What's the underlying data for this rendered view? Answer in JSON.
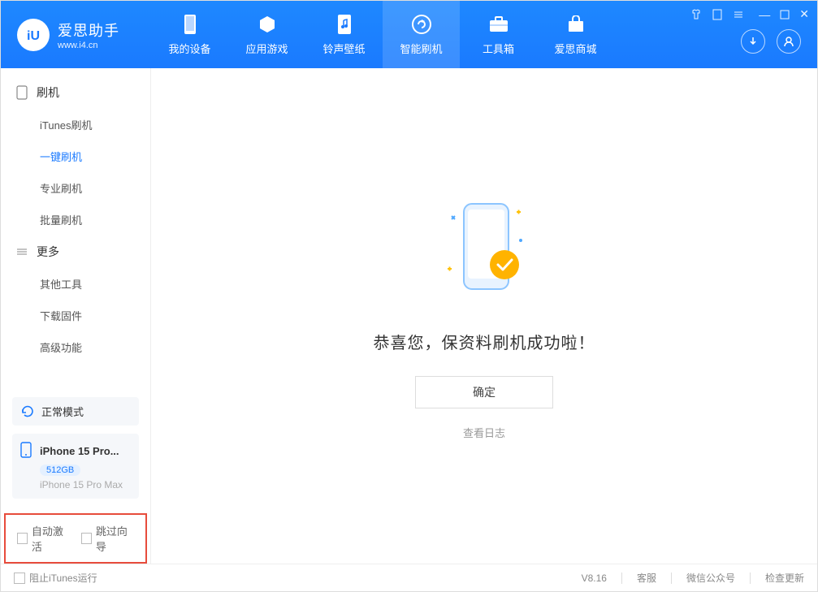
{
  "app": {
    "title": "爱思助手",
    "url": "www.i4.cn",
    "version": "V8.16"
  },
  "nav": {
    "tabs": [
      {
        "label": "我的设备"
      },
      {
        "label": "应用游戏"
      },
      {
        "label": "铃声壁纸"
      },
      {
        "label": "智能刷机"
      },
      {
        "label": "工具箱"
      },
      {
        "label": "爱思商城"
      }
    ]
  },
  "sidebar": {
    "group1": {
      "title": "刷机"
    },
    "items1": [
      {
        "label": "iTunes刷机"
      },
      {
        "label": "一键刷机"
      },
      {
        "label": "专业刷机"
      },
      {
        "label": "批量刷机"
      }
    ],
    "group2": {
      "title": "更多"
    },
    "items2": [
      {
        "label": "其他工具"
      },
      {
        "label": "下载固件"
      },
      {
        "label": "高级功能"
      }
    ],
    "mode_label": "正常模式",
    "device": {
      "name": "iPhone 15 Pro...",
      "storage": "512GB",
      "full_name": "iPhone 15 Pro Max"
    },
    "checkbox1": "自动激活",
    "checkbox2": "跳过向导"
  },
  "main": {
    "message": "恭喜您，保资料刷机成功啦！",
    "ok_label": "确定",
    "view_log": "查看日志"
  },
  "footer": {
    "block_itunes": "阻止iTunes运行",
    "support": "客服",
    "wechat": "微信公众号",
    "check_update": "检查更新"
  }
}
